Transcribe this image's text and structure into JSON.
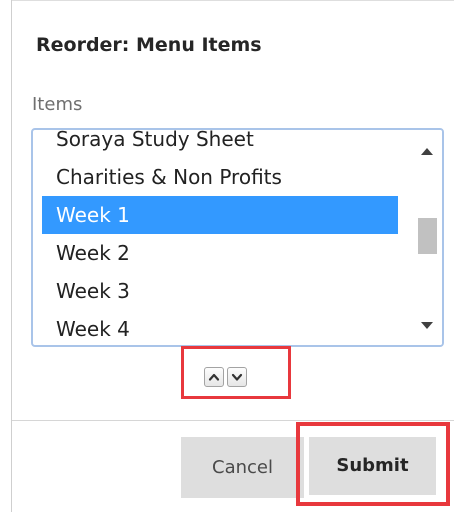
{
  "dialog": {
    "title": "Reorder: Menu Items",
    "items_label": "Items"
  },
  "list": {
    "items": [
      {
        "label": "Soraya Study Sheet",
        "selected": false
      },
      {
        "label": "Charities & Non Profits",
        "selected": false
      },
      {
        "label": "Week 1",
        "selected": true
      },
      {
        "label": "Week 2",
        "selected": false
      },
      {
        "label": "Week 3",
        "selected": false
      },
      {
        "label": "Week 4",
        "selected": false
      }
    ]
  },
  "icons": {
    "move_up": "chevron-up-icon",
    "move_down": "chevron-down-icon",
    "scroll_up": "scroll-up-arrow-icon",
    "scroll_down": "scroll-down-arrow-icon"
  },
  "colors": {
    "selection": "#3399ff",
    "highlight_box": "#e8383d",
    "list_border": "#a9c4e9",
    "button_bg": "#dedede"
  },
  "footer": {
    "cancel_label": "Cancel",
    "submit_label": "Submit"
  }
}
